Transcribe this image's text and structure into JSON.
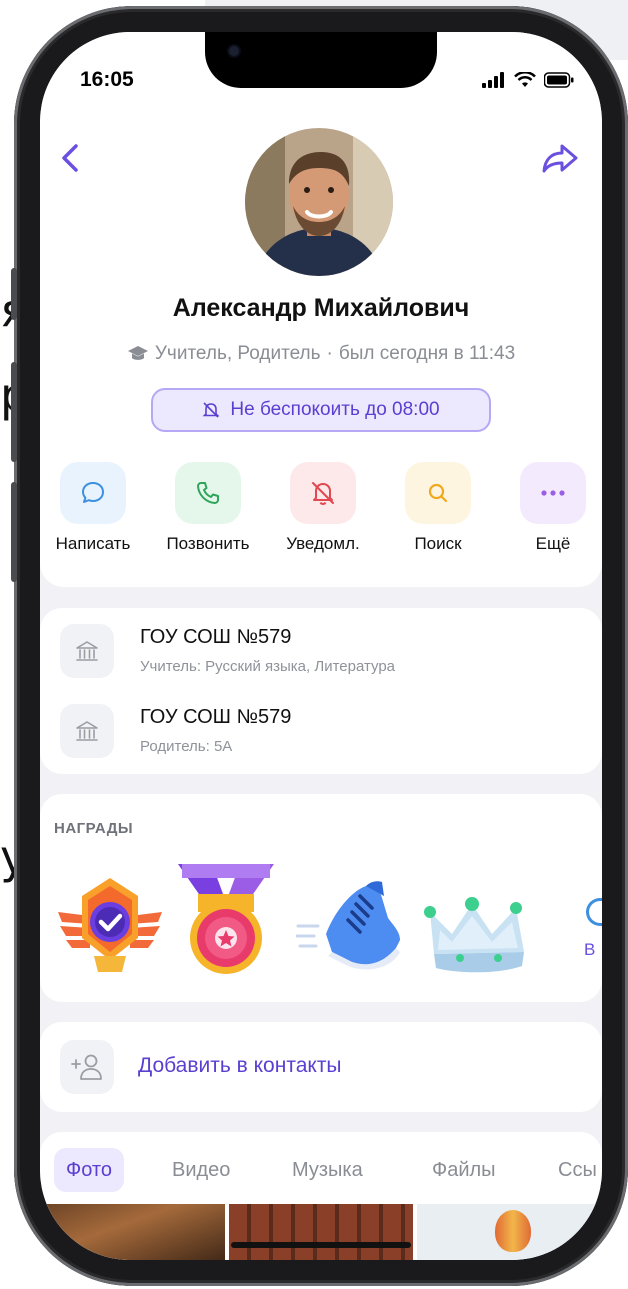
{
  "background": {
    "fragments": [
      "я",
      "р",
      "у"
    ]
  },
  "status_bar": {
    "time": "16:05"
  },
  "profile": {
    "name": "Александр Михайлович",
    "roles": "Учитель, Родитель",
    "separator": "·",
    "last_seen": "был сегодня в 11:43",
    "dnd_label": "Не беспокоить до 08:00"
  },
  "actions": [
    {
      "label": "Написать",
      "icon": "message-icon",
      "bg": "#e9f3fd",
      "color": "#3d8fe0"
    },
    {
      "label": "Позвонить",
      "icon": "phone-icon",
      "bg": "#e4f7ea",
      "color": "#2fa55a"
    },
    {
      "label": "Уведомл.",
      "icon": "bell-off-icon",
      "bg": "#fde8ea",
      "color": "#e2484f"
    },
    {
      "label": "Поиск",
      "icon": "search-icon",
      "bg": "#fef5e1",
      "color": "#f0a81c"
    },
    {
      "label": "Ещё",
      "icon": "more-icon",
      "bg": "#f3ebfd",
      "color": "#9b5de5"
    }
  ],
  "schools": [
    {
      "title": "ГОУ СОШ №579",
      "subtitle": "Учитель: Русский языка, Литература"
    },
    {
      "title": "ГОУ СОШ №579",
      "subtitle": "Родитель: 5А"
    }
  ],
  "awards": {
    "title": "НАГРАДЫ",
    "items": [
      "winged-badge-icon",
      "medal-icon",
      "sneaker-icon",
      "crown-icon"
    ],
    "more_label": "В"
  },
  "add_contact": {
    "label": "Добавить в контакты"
  },
  "media_tabs": [
    {
      "label": "Фото",
      "active": true
    },
    {
      "label": "Видео",
      "active": false
    },
    {
      "label": "Музыка",
      "active": false
    },
    {
      "label": "Файлы",
      "active": false
    },
    {
      "label": "Ссы",
      "active": false
    }
  ],
  "colors": {
    "accent": "#5b3fd0",
    "accent_light": "#ece8fd",
    "muted": "#8a8d94"
  }
}
